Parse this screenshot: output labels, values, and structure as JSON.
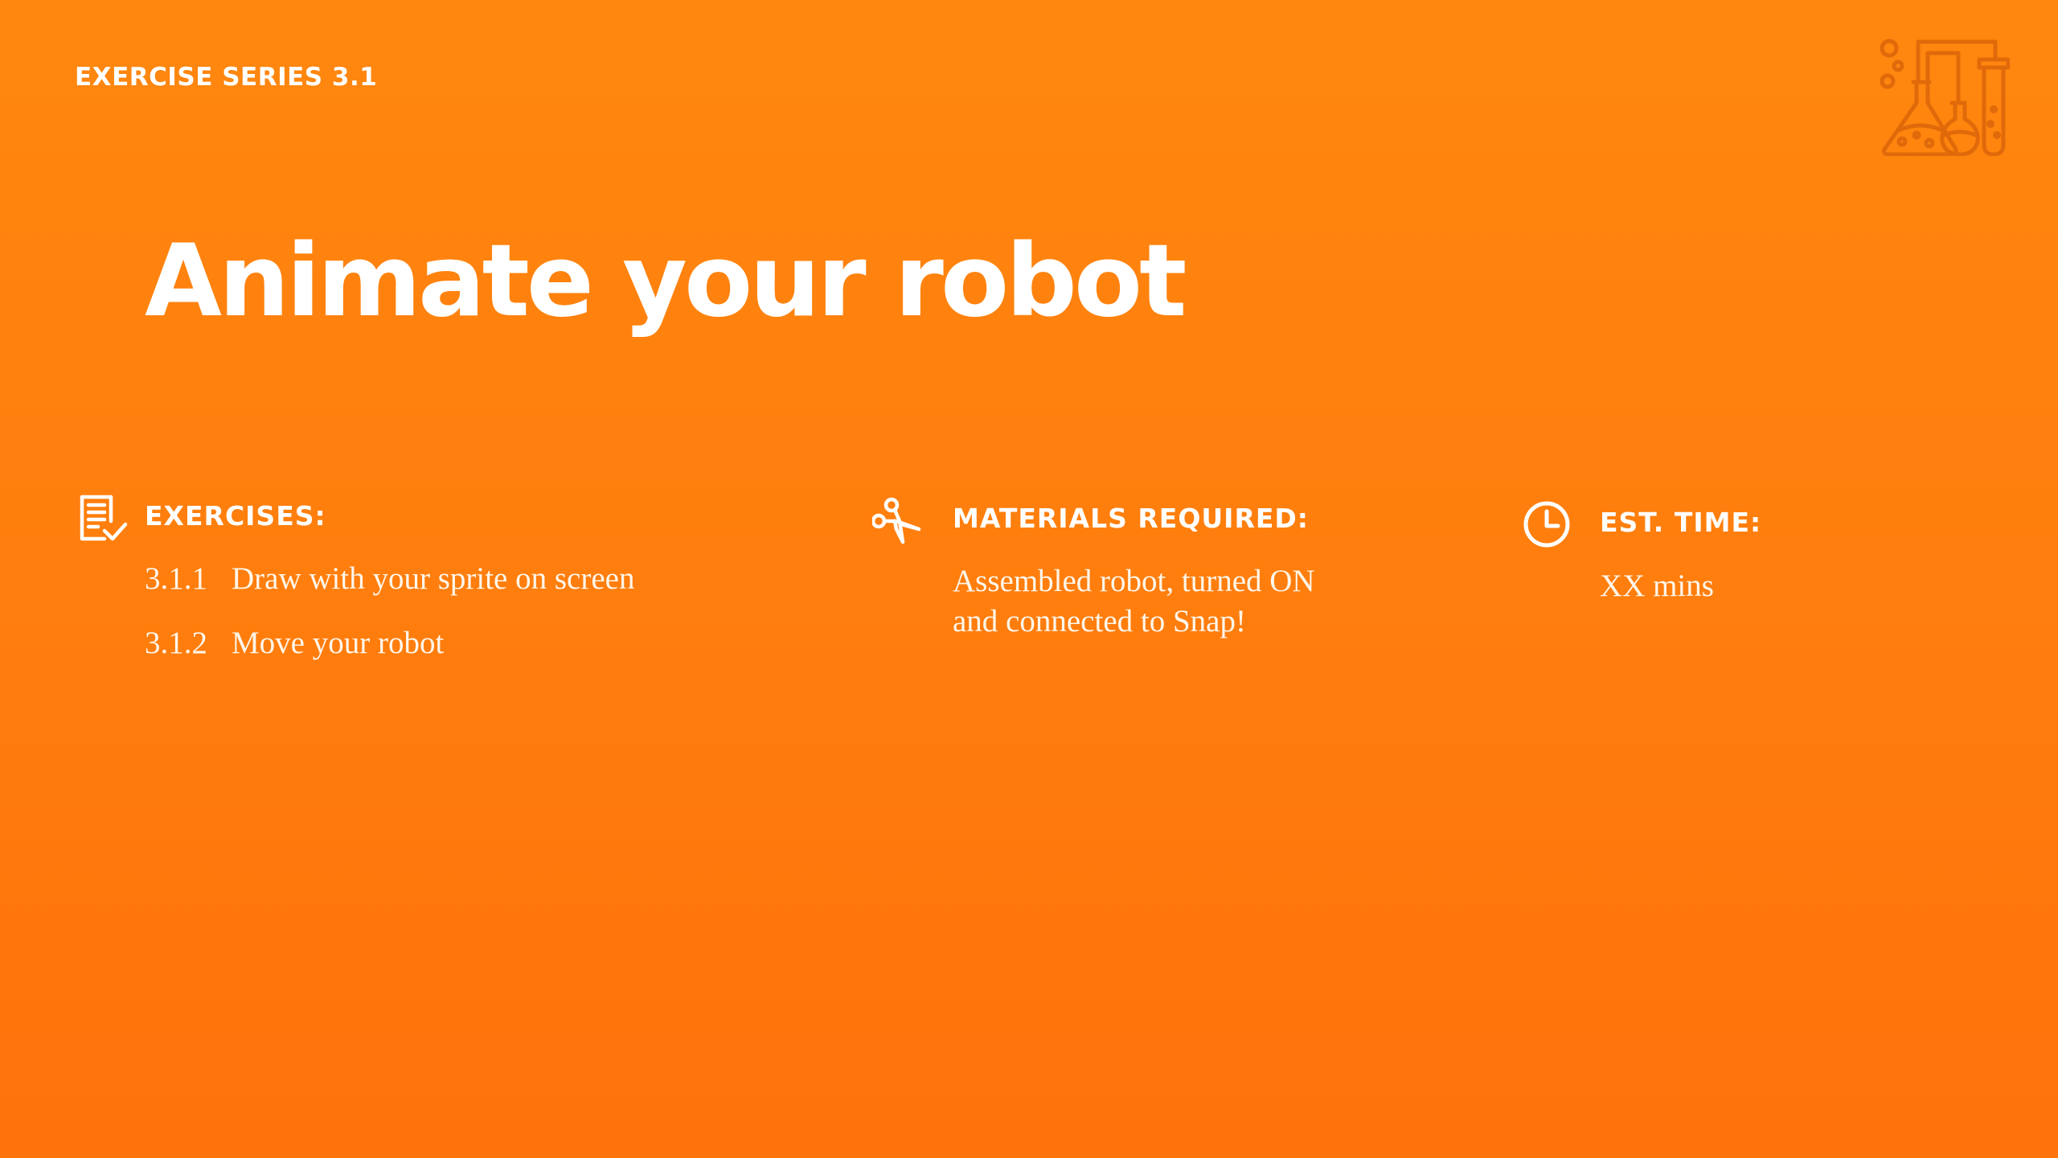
{
  "header": {
    "series_label": "EXERCISE SERIES 3.1",
    "lab_icon": "science-lab-icon"
  },
  "title": "Animate your robot",
  "exercises": {
    "icon": "checklist-icon",
    "heading": "EXERCISES:",
    "items": [
      {
        "number": "3.1.1",
        "label": "Draw with your sprite on screen"
      },
      {
        "number": "3.1.2",
        "label": "Move your robot"
      }
    ]
  },
  "materials": {
    "icon": "scissors-icon",
    "heading": "MATERIALS REQUIRED:",
    "line1": "Assembled robot, turned ON",
    "line2": "and connected to Snap!"
  },
  "time": {
    "icon": "clock-icon",
    "heading": "EST. TIME:",
    "value": "XX mins"
  },
  "colors": {
    "background_top": "#ff870f",
    "background_bottom": "#ff720c",
    "text": "#ffffff",
    "lab_icon": "#e06a0a"
  }
}
